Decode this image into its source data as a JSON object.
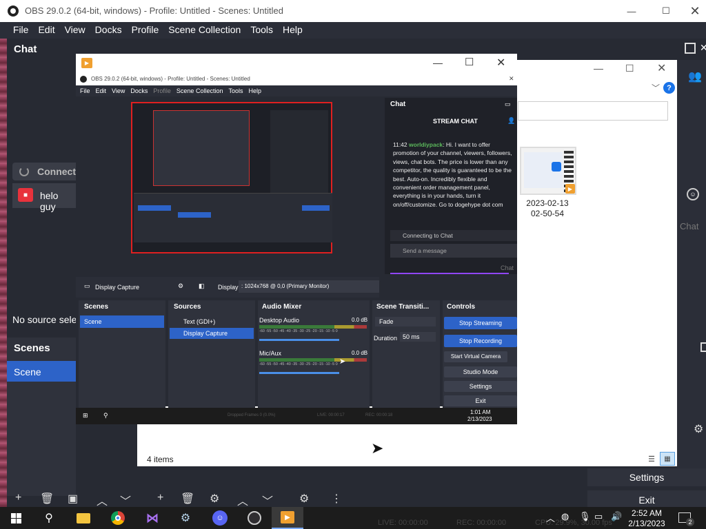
{
  "main": {
    "title": "OBS 29.0.2 (64-bit, windows) - Profile: Untitled - Scenes: Untitled",
    "menu": [
      "File",
      "Edit",
      "View",
      "Docks",
      "Profile",
      "Scene Collection",
      "Tools",
      "Help"
    ],
    "chat_title": "Chat",
    "connect_text": "Connecti",
    "chat_message": "helo guy",
    "no_source": "No source selec",
    "scenes_title": "Scenes",
    "scene_item": "Scene",
    "right_chat": "Chat",
    "settings_label": "Settings",
    "exit_label": "Exit",
    "status_live": "LIVE: 00:00:00",
    "status_rec": "REC: 00:00:00",
    "status_cpu": "CPU: 29.9%, 30.00 fps"
  },
  "explorer": {
    "thumb_caption_1": "2023-02-13",
    "thumb_caption_2": "02-50-54",
    "item_count": "4 items"
  },
  "nested": {
    "title": "OBS 29.0.2 (64-bit, windows) - Profile: Untitled - Scenes: Untitled",
    "menu": [
      "File",
      "Edit",
      "View",
      "Docks",
      "Profile",
      "Scene Collection",
      "Tools",
      "Help"
    ],
    "chat_dock_title": "Chat",
    "stream_chat": "STREAM CHAT",
    "msg_time": "11:42",
    "msg_user": "worldiypack",
    "msg_text": "Hi. I want to offer promotion of your channel, viewers, followers, views, chat bots. The price is lower than any competitor, the quality is guaranteed to be the best. Auto-on. Incredibly flexible and convenient order management panel, everything is in your hands, turn it on/off/customize. Go to dogehype dot com",
    "connecting": "Connecting to Chat",
    "send_placeholder": "Send a message",
    "chat_btn": "Chat",
    "source_name": "Display Capture",
    "display_label": "Display",
    "display_value": ": 1024x768 @ 0,0 (Primary Monitor)",
    "docks": {
      "scenes": "Scenes",
      "sources": "Sources",
      "mixer": "Audio Mixer",
      "transitions": "Scene Transiti...",
      "controls": "Controls"
    },
    "scene_item": "Scene",
    "sources": [
      {
        "label": "Text (GDI+)"
      },
      {
        "label": "Display Capture"
      }
    ],
    "mixer": [
      {
        "name": "Desktop Audio",
        "db": "0.0 dB"
      },
      {
        "name": "Mic/Aux",
        "db": "0.0 dB"
      }
    ],
    "meter_ticks": "-60 -55 -50 -45 -40 -35 -30 -25 -20 -15 -10 -5 0",
    "transition": "Fade",
    "duration_label": "Duration",
    "duration_value": "50 ms",
    "controls": [
      "Stop Streaming",
      "Stop Recording",
      "Start Virtual Camera",
      "Studio Mode",
      "Settings",
      "Exit"
    ],
    "status_dropped": "Dropped Frames 0 (0.0%)",
    "status_live": "LIVE: 00:00:17",
    "status_rec": "REC: 00:00:18",
    "taskbar_time": "1:01 AM",
    "taskbar_date": "2/13/2023"
  },
  "taskbar": {
    "time": "2:52 AM",
    "date": "2/13/2023",
    "notif_count": "2",
    "apps": [
      "start-icon",
      "search-icon",
      "file-explorer-icon",
      "chrome-icon",
      "visual-studio-icon",
      "steam-icon",
      "discord-icon",
      "obs-icon",
      "video-app-icon"
    ]
  },
  "colors": {
    "obs_dark": "#272a33",
    "obs_blue": "#2d63c8",
    "twitch_purple": "#9146ff",
    "accent_red": "#e8323c"
  }
}
